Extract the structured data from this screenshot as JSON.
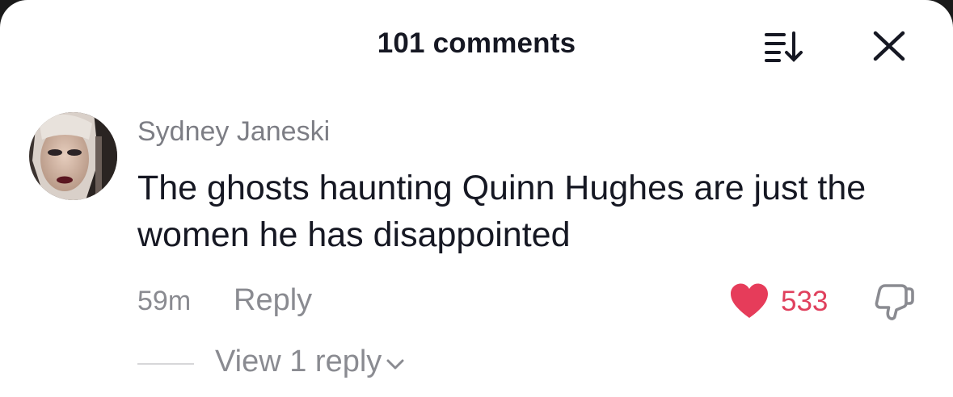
{
  "header": {
    "title": "101 comments",
    "sort_icon": "sort-descending-icon",
    "close_icon": "close-icon"
  },
  "comment": {
    "username": "Sydney Janeski",
    "text": "The ghosts haunting Quinn Hughes are just the women he has disappointed",
    "timestamp": "59m",
    "reply_label": "Reply",
    "like_count": "533",
    "liked": true,
    "view_replies_label": "View 1 reply"
  },
  "colors": {
    "like_red": "#e63c5a",
    "text_primary": "#161823",
    "text_secondary": "#8a8b91"
  }
}
